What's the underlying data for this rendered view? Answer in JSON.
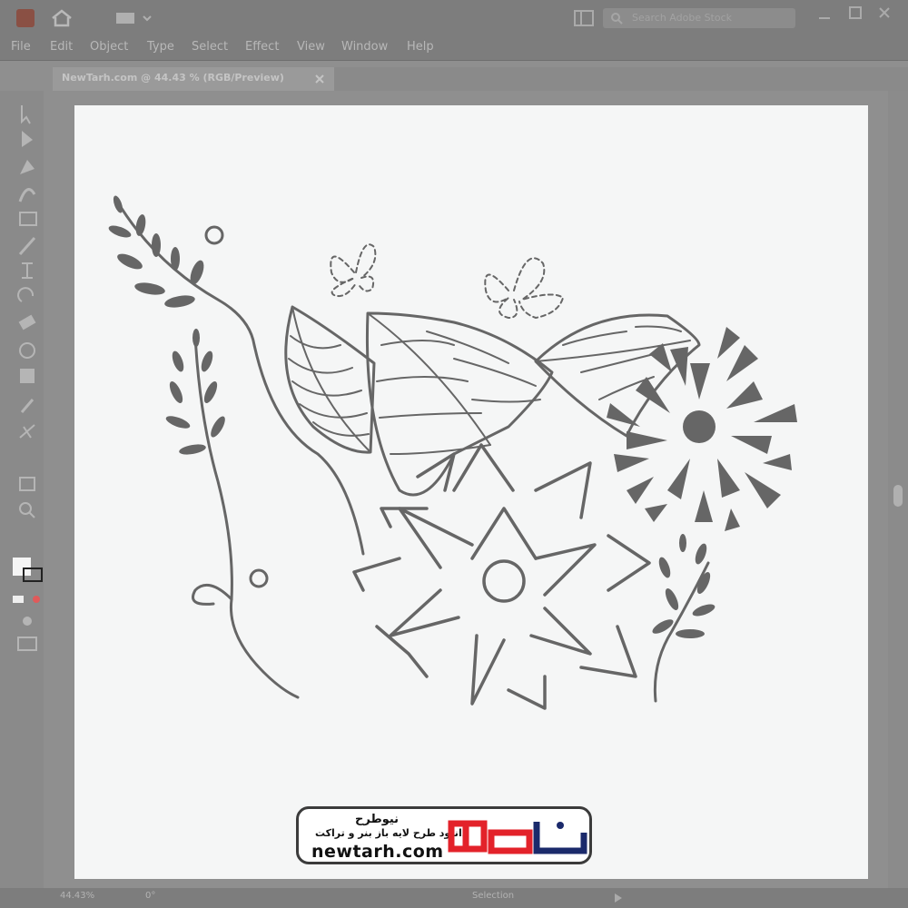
{
  "menu": {
    "items": [
      "File",
      "Edit",
      "Object",
      "Type",
      "Select",
      "Effect",
      "View",
      "Window",
      "Help"
    ]
  },
  "document": {
    "tab_title": "NewTarh.com @ 44.43 % (RGB/Preview)"
  },
  "search": {
    "placeholder": "Search Adobe Stock"
  },
  "status": {
    "zoom": "44.43%",
    "rotation": "0°",
    "tool": "Selection"
  },
  "watermark": {
    "name_fa": "نیوطرح",
    "tagline_fa": "دانلود طرح لایه باز بنر و تراکت",
    "url": "newtarh.com",
    "logo_text": "نیوطرح"
  },
  "colors": {
    "artwork": "#666666",
    "logo_red": "#e3222a",
    "canvas": "#f5f6f6"
  }
}
